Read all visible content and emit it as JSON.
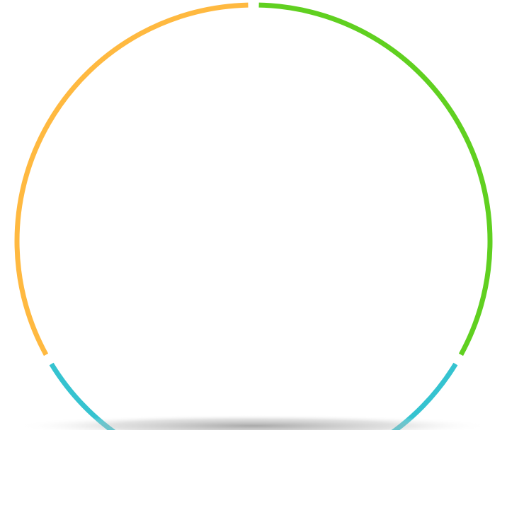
{
  "chart_data": {
    "type": "pie",
    "variant": "donut-ring",
    "slices": [
      {
        "value": 1,
        "color": "#60D020"
      },
      {
        "value": 1,
        "color": "#35C3D0"
      },
      {
        "value": 1,
        "color": "#FFB940"
      }
    ],
    "start_angle_deg": 0,
    "direction": "clockwise",
    "gap_between_slices": true,
    "shadow_below": true
  }
}
